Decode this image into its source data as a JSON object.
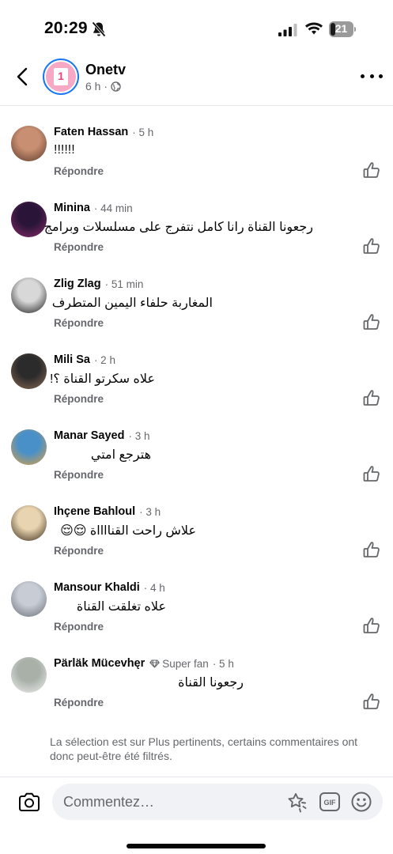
{
  "status_bar": {
    "time": "20:29",
    "battery": "21"
  },
  "header": {
    "page_name": "Onetv",
    "time_ago": "6 h ·"
  },
  "comments": [
    {
      "author": "Faten Hassan",
      "time": "· 5 h",
      "text": "!!!!!!",
      "reply": "Répondre",
      "avatar_colors": [
        "#c98f72",
        "#5a3a2a"
      ]
    },
    {
      "author": "Minina",
      "time": "· 44 min",
      "text": "رجعونا القناة رانا كامل نتفرج على مسلسلات وبرامج",
      "reply": "Répondre",
      "avatar_colors": [
        "#2a1538",
        "#8a2a6a"
      ]
    },
    {
      "author": "Zlig Zlag",
      "time": "· 51 min",
      "text": "المغاربة حلفاء اليمين المتطرف",
      "reply": "Répondre",
      "avatar_colors": [
        "#d8d8d8",
        "#1a1a1a"
      ]
    },
    {
      "author": "Mili Sa",
      "time": "· 2 h",
      "text": "علاه سكرتو القناة ؟!",
      "reply": "Répondre",
      "avatar_colors": [
        "#2b2b2b",
        "#8b6a55"
      ]
    },
    {
      "author": "Manar Sayed",
      "time": "· 3 h",
      "text": "هترجع امتي",
      "reply": "Répondre",
      "avatar_colors": [
        "#4a90c8",
        "#e0a040"
      ]
    },
    {
      "author": "Ihçene Bahloul",
      "time": "· 3 h",
      "text": "علاش راحت القنااااة 😌😌",
      "reply": "Répondre",
      "avatar_colors": [
        "#e8d4b0",
        "#3a2a1a"
      ]
    },
    {
      "author": "Mansour Khaldi",
      "time": "· 4 h",
      "text": "علاه تغلقت القناة",
      "reply": "Répondre",
      "avatar_colors": [
        "#c8ccd4",
        "#6a6e78"
      ]
    },
    {
      "author": "Pärläk Mücevhęr",
      "time": "· 5 h",
      "badge": "Super fan",
      "text": "رجعونا القناة",
      "reply": "Répondre",
      "avatar_colors": [
        "#a8b0a8",
        "#f0f0f0"
      ]
    }
  ],
  "filter_note": "La sélection est sur Plus pertinents, certains commentaires ont donc peut-être été filtrés.",
  "composer": {
    "placeholder": "Commentez…"
  },
  "icons": {
    "back": "chevron-left-icon",
    "more": "more-dots-icon",
    "like": "thumbs-up-icon",
    "camera": "camera-icon",
    "sticker": "sticker-icon",
    "gif": "gif-icon",
    "emoji": "emoji-icon",
    "globe": "globe-icon",
    "diamond": "diamond-icon"
  },
  "colors": {
    "accent": "#1877f2",
    "secondary_text": "#65676b",
    "primary_text": "#050505"
  }
}
